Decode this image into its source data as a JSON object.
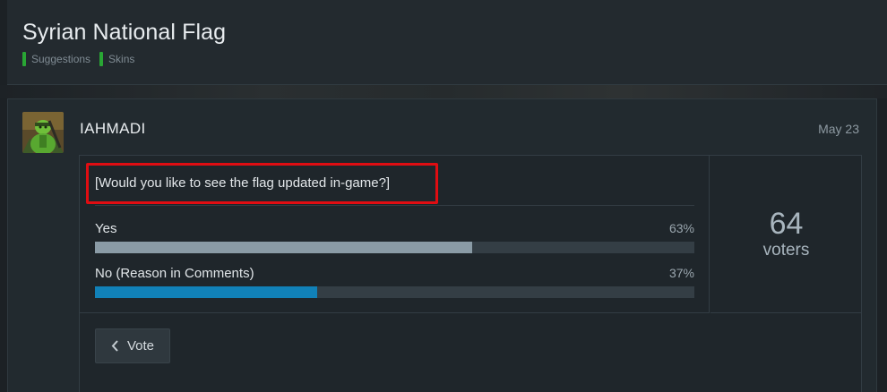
{
  "header": {
    "title": "Syrian National Flag",
    "tags": [
      "Suggestions",
      "Skins"
    ],
    "tag_color": "#29a634"
  },
  "post": {
    "username": "IAHMADI",
    "date": "May 23",
    "avatar": "soldier-avatar-icon"
  },
  "poll": {
    "question": "[Would you like to see the flag updated in-game?]",
    "highlight_color": "#e00d12",
    "options": [
      {
        "label": "Yes",
        "percent_label": "63%",
        "fill_fraction": 0.63,
        "color": "#8a9ba6"
      },
      {
        "label": "No (Reason in Comments)",
        "percent_label": "37%",
        "fill_fraction": 0.37,
        "color": "#1181b8"
      }
    ],
    "voter_count": "64",
    "voter_label": "voters",
    "vote_button_label": "Vote",
    "vote_button_icon": "chevron-left-icon"
  }
}
